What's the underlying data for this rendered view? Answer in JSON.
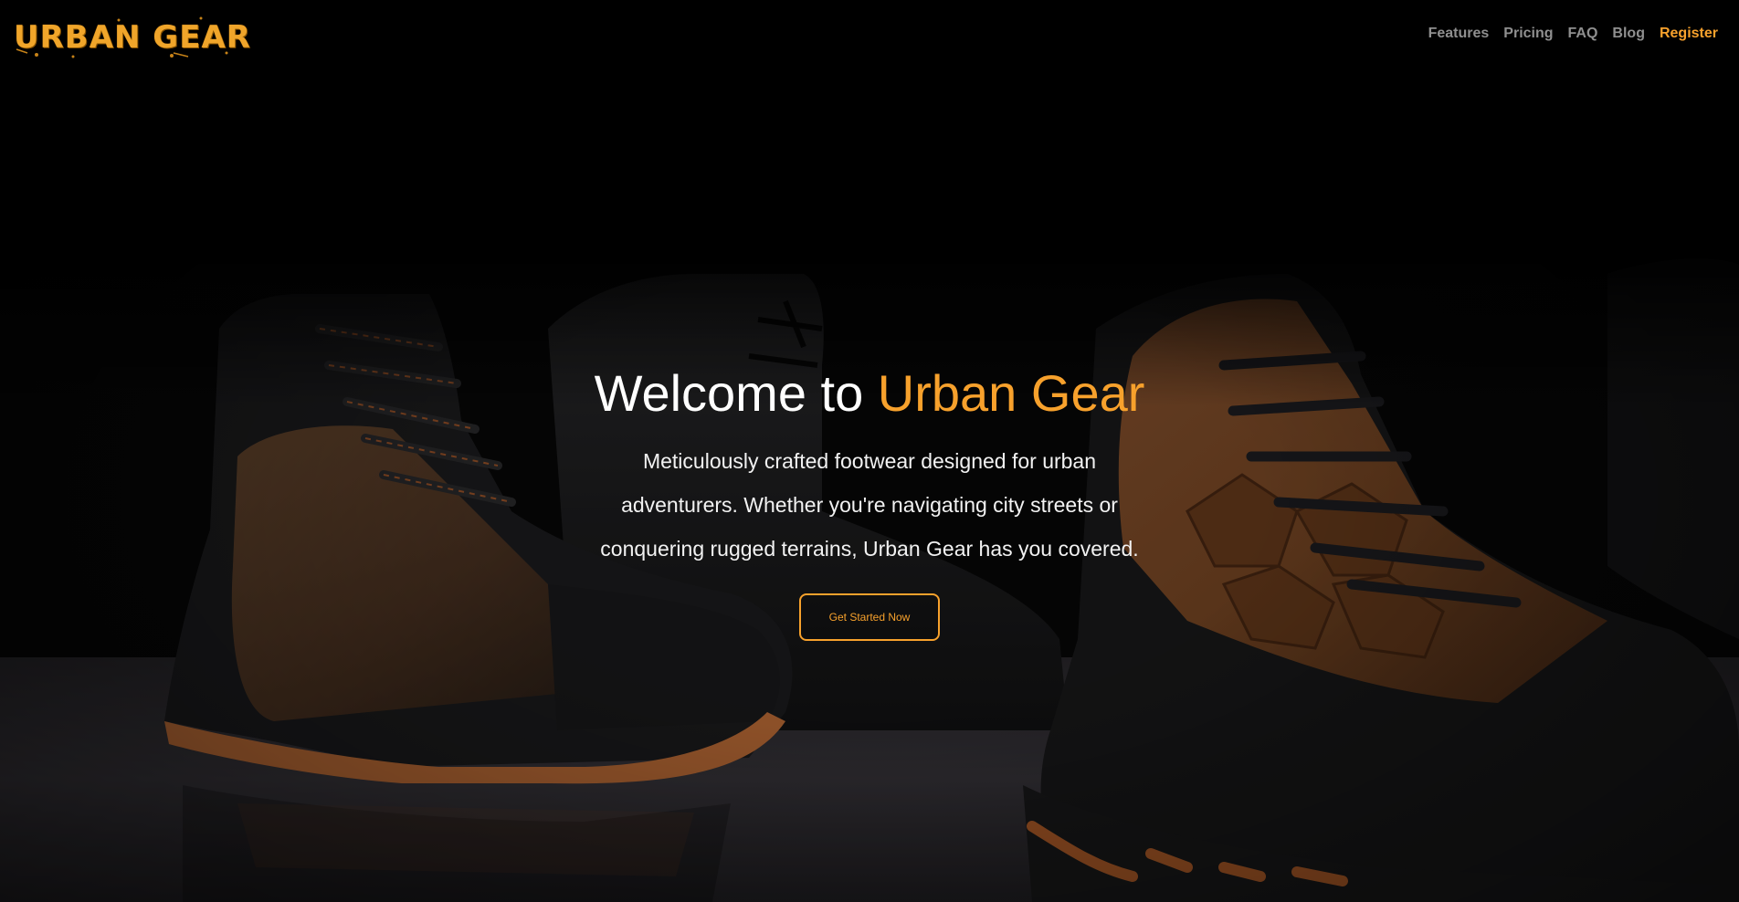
{
  "brand": {
    "logo_text": "URBAN GEAR",
    "accent_color": "#f7a12c"
  },
  "nav": {
    "items": [
      {
        "label": "Features"
      },
      {
        "label": "Pricing"
      },
      {
        "label": "FAQ"
      },
      {
        "label": "Blog"
      }
    ],
    "register_label": "Register"
  },
  "hero": {
    "title_prefix": "Welcome to ",
    "title_accent": "Urban Gear",
    "subtitle": "Meticulously crafted footwear designed for urban adventurers. Whether you're navigating city streets or conquering rugged terrains, Urban Gear has you covered.",
    "cta_label": "Get Started Now"
  }
}
